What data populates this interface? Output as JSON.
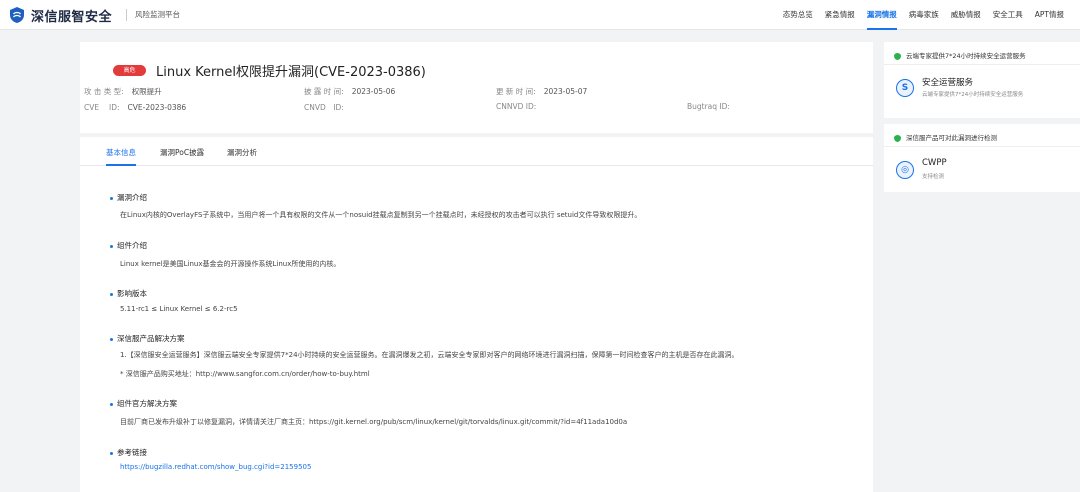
{
  "brand": {
    "name": "深信服智安全",
    "subtitle": "风险监测平台"
  },
  "nav": [
    "态势总览",
    "紧急情报",
    "漏洞情报",
    "病毒家族",
    "威胁情报",
    "安全工具",
    "APT情报"
  ],
  "nav_active_index": 2,
  "vuln": {
    "badge": "高危",
    "title": "Linux Kernel权限提升漏洞(CVE-2023-0386)",
    "attack_type_label": "攻 击 类 型:",
    "attack_type_value": "权限提升",
    "disclosed_label": "披 露 时 间:",
    "disclosed_value": "2023-05-06",
    "updated_label": "更 新 时 间:",
    "updated_value": "2023-05-07",
    "cve_label": "CVE　 ID:",
    "cve_value": "CVE-2023-0386",
    "cnvd_label": "CNVD　ID:",
    "cnvd_value": "",
    "cnnvd_label": "CNNVD ID:",
    "cnnvd_value": "",
    "bugtraq_label": "Bugtraq ID:",
    "bugtraq_value": ""
  },
  "tabs": [
    "基本信息",
    "漏洞PoC披露",
    "漏洞分析"
  ],
  "sections": {
    "intro_title": "漏洞介绍",
    "intro_text": "在Linux内核的OverlayFS子系统中，当用户将一个具有权限的文件从一个nosuid挂载点复制到另一个挂载点时，未经授权的攻击者可以执行 setuid文件导致权限提升。",
    "component_title": "组件介绍",
    "component_text": "Linux kernel是美国Linux基金会的开源操作系统Linux所使用的内核。",
    "version_title": "影响版本",
    "version_text": "5.11-rc1 ≤ Linux Kernel ≤ 6.2-rc5",
    "solution_title": "深信服产品解决方案",
    "solution_text1": "1.【深信服安全运营服务】深信服云端安全专家提供7*24小时持续的安全运营服务。在漏洞爆发之初，云端安全专家即对客户的网络环境进行漏洞扫描，保障第一时间检查客户的主机是否存在此漏洞。",
    "solution_text2": "* 深信服产品购买地址：http://www.sangfor.com.cn/order/how-to-buy.html",
    "official_title": "组件官方解决方案",
    "official_text": "目前厂商已发布升级补丁以修复漏洞，详情请关注厂商主页：https://git.kernel.org/pub/scm/linux/kernel/git/torvalds/linux.git/commit/?id=4f11ada10d0a",
    "ref_title": "参考链接",
    "ref_text": "https://bugzilla.redhat.com/show_bug.cgi?id=2159505"
  },
  "side": {
    "panel1_head": "云端专家提供7*24小时持续安全运营服务",
    "panel1_svc_name": "安全运营服务",
    "panel1_svc_desc": "云端专家提供7*24小时持续安全运营服务",
    "panel1_icon": "S",
    "panel2_head": "深信服产品可对此漏洞进行检测",
    "panel2_svc_name": "CWPP",
    "panel2_svc_desc": "支持检测",
    "panel2_icon": "◎"
  },
  "colors": {
    "accent": "#1a73e8",
    "danger": "#e23b3b",
    "shield": "#2bb24c"
  }
}
